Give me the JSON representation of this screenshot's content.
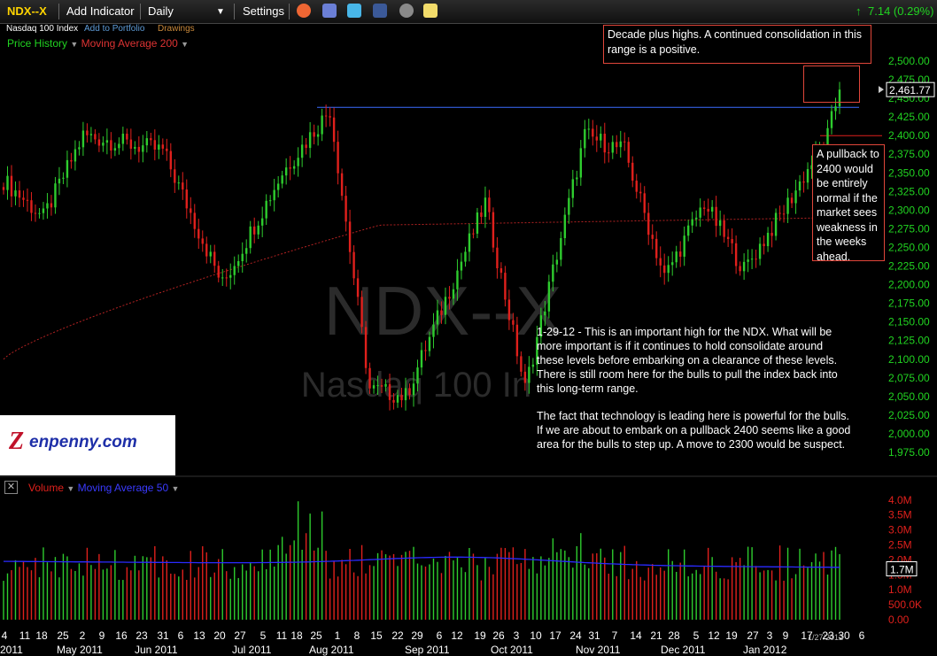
{
  "toolbar": {
    "symbol": "NDX--X",
    "add_indicator": "Add Indicator",
    "interval": "Daily",
    "settings": "Settings",
    "change": "7.14 (0.29%)",
    "icons": [
      "alarm-icon",
      "layers-icon",
      "twitter-icon",
      "facebook-icon",
      "camera-icon",
      "note-icon"
    ]
  },
  "subbar": {
    "name": "Nasdaq 100 Index",
    "add_portfolio": "Add to Portfolio",
    "drawings": "Drawings"
  },
  "price_legend": {
    "price_history": "Price History",
    "moving_average": "Moving Average 200"
  },
  "volume_legend": {
    "volume": "Volume",
    "moving_average": "Moving Average 50"
  },
  "watermark": {
    "symbol": "NDX--X",
    "name": "Nasdaq 100 In"
  },
  "logo": {
    "text": "Zenpenny.com"
  },
  "annotations": {
    "top_box": "Decade plus highs. A continued consolidation in this range is a positive.",
    "right_box": [
      "A pullback to",
      "2400 would",
      "be entirely",
      "normal if the",
      "market sees",
      "weakness in",
      "the weeks",
      "ahead."
    ],
    "main_note_1": [
      "1-29-12 - This is an important high for the NDX. What will be",
      "more important is if it continues to hold consolidate around",
      "these levels before embarking on a clearance of these levels.",
      "There is still room here for the bulls to pull the index back into",
      "this long-term range."
    ],
    "main_note_2": [
      "The fact that technology is leading here is powerful for the bulls.",
      "If we are about to embark on a pullback 2400 seems like a good",
      "area for the bulls to step up. A move to 2300 would be suspect."
    ]
  },
  "colors": {
    "up": "#2ecc2e",
    "down": "#e0201c",
    "ma200": "#b22222",
    "ma50": "#2a2aff",
    "resistance": "#3a6cff",
    "box": "#e0463a"
  },
  "chart_data": [
    {
      "type": "candlestick",
      "title": "NDX--X",
      "price_axis_ticks": [
        "2,500.00",
        "2,475.00",
        "2,450.00",
        "2,425.00",
        "2,400.00",
        "2,375.00",
        "2,350.00",
        "2,325.00",
        "2,300.00",
        "2,275.00",
        "2,250.00",
        "2,225.00",
        "2,200.00",
        "2,175.00",
        "2,150.00",
        "2,125.00",
        "2,100.00",
        "2,075.00",
        "2,050.00",
        "2,025.00",
        "2,000.00",
        "1,975.00"
      ],
      "ylim": [
        1960,
        2515
      ],
      "last_price": "2,461.77",
      "resistance_level": 2438,
      "pullback_level": 2400,
      "x_tick_labels": [
        "4",
        "11",
        "18",
        "25",
        "2",
        "9",
        "16",
        "23",
        "31",
        "6",
        "13",
        "20",
        "27",
        "5",
        "11",
        "18",
        "25",
        "1",
        "8",
        "15",
        "22",
        "29",
        "6",
        "12",
        "19",
        "26",
        "3",
        "10",
        "17",
        "24",
        "31",
        "7",
        "14",
        "21",
        "28",
        "5",
        "12",
        "19",
        "27",
        "3",
        "9",
        "17",
        "23",
        "30",
        "6"
      ],
      "month_labels": [
        "2011",
        "May 2011",
        "Jun 2011",
        "Jul 2011",
        "Aug 2011",
        "Sep 2011",
        "Oct 2011",
        "Nov 2011",
        "Dec 2011",
        "Jan 2012"
      ],
      "keypoints": [
        {
          "date": "Apr 2011",
          "close": 2340
        },
        {
          "date": "Apr 25 2011",
          "close": 2290
        },
        {
          "date": "May 2 2011",
          "close": 2400
        },
        {
          "date": "May 30 2011",
          "close": 2380
        },
        {
          "date": "Jun 20 2011",
          "close": 2200
        },
        {
          "date": "Jul 11 2011",
          "close": 2350
        },
        {
          "date": "Jul 25 2011",
          "close": 2435
        },
        {
          "date": "Aug 8 2011",
          "close": 2060
        },
        {
          "date": "Aug 22 2011",
          "close": 2050
        },
        {
          "date": "Sep 19 2011",
          "close": 2310
        },
        {
          "date": "Oct 3 2011",
          "close": 2060
        },
        {
          "date": "Oct 24 2011",
          "close": 2400
        },
        {
          "date": "Nov 7 2011",
          "close": 2380
        },
        {
          "date": "Nov 21 2011",
          "close": 2210
        },
        {
          "date": "Dec 5 2011",
          "close": 2310
        },
        {
          "date": "Dec 19 2011",
          "close": 2220
        },
        {
          "date": "Jan 3 2012",
          "close": 2300
        },
        {
          "date": "Jan 20 2012",
          "close": 2400
        },
        {
          "date": "Jan 27 2012",
          "close": 2461.77
        }
      ],
      "ma200": [
        {
          "date": "Apr 2011",
          "value": 2100
        },
        {
          "date": "Aug 2011",
          "value": 2280
        },
        {
          "date": "Jan 27 2012",
          "value": 2290
        }
      ]
    },
    {
      "type": "bar",
      "title": "Volume",
      "axis_ticks": [
        "4.0M",
        "3.5M",
        "3.0M",
        "2.5M",
        "2.0M",
        "1.5M",
        "1.0M",
        "500.0K",
        "0.00"
      ],
      "ylim": [
        0,
        4.2
      ],
      "unit": "M",
      "last_volume": "1.7M",
      "ma50_level": 2.0,
      "last_date": "1/27/2012"
    }
  ]
}
